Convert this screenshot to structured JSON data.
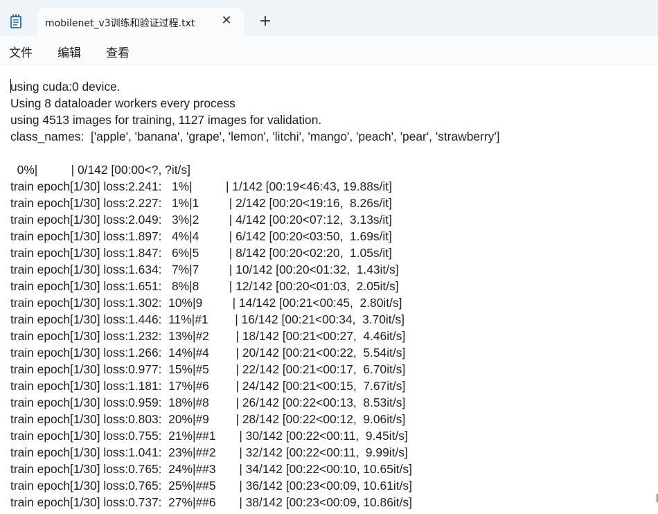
{
  "tab": {
    "title": "mobilenet_v3训练和验证过程.txt",
    "close_glyph": "✕",
    "new_tab_glyph": "+"
  },
  "icons": {
    "app": "notepad-icon",
    "close": "close-icon",
    "new_tab": "plus-icon"
  },
  "menu": [
    "文件",
    "编辑",
    "查看"
  ],
  "editor": {
    "lines": [
      "using cuda:0 device.",
      "Using 8 dataloader workers every process",
      "using 4513 images for training, 1127 images for validation.",
      "class_names:  ['apple', 'banana', 'grape', 'lemon', 'litchi', 'mango', 'peach', 'pear', 'strawberry']",
      "",
      "  0%|          | 0/142 [00:00<?, ?it/s]",
      "train epoch[1/30] loss:2.241:   1%|          | 1/142 [00:19<46:43, 19.88s/it]",
      "train epoch[1/30] loss:2.227:   1%|1         | 2/142 [00:20<19:16,  8.26s/it]",
      "train epoch[1/30] loss:2.049:   3%|2         | 4/142 [00:20<07:12,  3.13s/it]",
      "train epoch[1/30] loss:1.897:   4%|4         | 6/142 [00:20<03:50,  1.69s/it]",
      "train epoch[1/30] loss:1.847:   6%|5         | 8/142 [00:20<02:20,  1.05s/it]",
      "train epoch[1/30] loss:1.634:   7%|7         | 10/142 [00:20<01:32,  1.43it/s]",
      "train epoch[1/30] loss:1.651:   8%|8         | 12/142 [00:20<01:03,  2.05it/s]",
      "train epoch[1/30] loss:1.302:  10%|9         | 14/142 [00:21<00:45,  2.80it/s]",
      "train epoch[1/30] loss:1.446:  11%|#1        | 16/142 [00:21<00:34,  3.70it/s]",
      "train epoch[1/30] loss:1.232:  13%|#2        | 18/142 [00:21<00:27,  4.46it/s]",
      "train epoch[1/30] loss:1.266:  14%|#4        | 20/142 [00:21<00:22,  5.54it/s]",
      "train epoch[1/30] loss:0.977:  15%|#5        | 22/142 [00:21<00:17,  6.70it/s]",
      "train epoch[1/30] loss:1.181:  17%|#6        | 24/142 [00:21<00:15,  7.67it/s]",
      "train epoch[1/30] loss:0.959:  18%|#8        | 26/142 [00:22<00:13,  8.53it/s]",
      "train epoch[1/30] loss:0.803:  20%|#9        | 28/142 [00:22<00:12,  9.06it/s]",
      "train epoch[1/30] loss:0.755:  21%|##1       | 30/142 [00:22<00:11,  9.45it/s]",
      "train epoch[1/30] loss:1.041:  23%|##2       | 32/142 [00:22<00:11,  9.99it/s]",
      "train epoch[1/30] loss:0.765:  24%|##3       | 34/142 [00:22<00:10, 10.65it/s]",
      "train epoch[1/30] loss:0.765:  25%|##5       | 36/142 [00:23<00:09, 10.61it/s]",
      "train epoch[1/30] loss:0.737:  27%|##6       | 38/142 [00:23<00:09, 10.86it/s]"
    ]
  },
  "colors": {
    "titlebar_bg": "#eff4f9",
    "tab_bg": "#f9fbfd",
    "editor_bg": "#ffffff",
    "text": "#1f1f1f",
    "icon_blue": "#2b7cd3"
  }
}
